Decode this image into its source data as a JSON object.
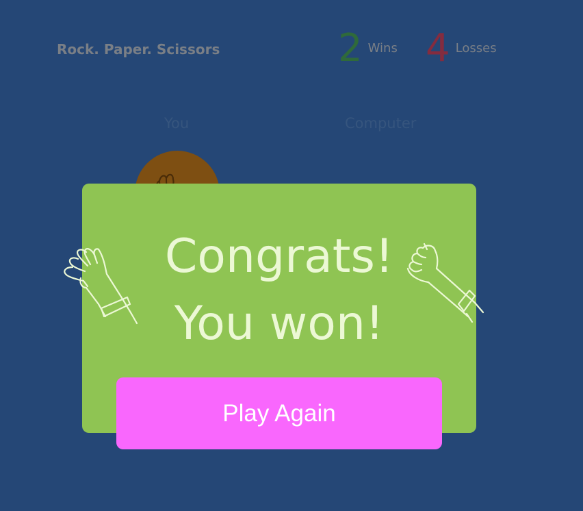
{
  "header": {
    "title": "Rock. Paper. Scissors"
  },
  "score": {
    "wins": {
      "value": "2",
      "label": "Wins",
      "color": "#2f6a3a"
    },
    "losses": {
      "value": "4",
      "label": "Losses",
      "color": "#842c3f"
    }
  },
  "players": {
    "you_label": "You",
    "computer_label": "Computer",
    "you_choice_icon": "hand-icon"
  },
  "modal": {
    "line1": "Congrats!",
    "line2": "You won!",
    "button_label": "Play Again",
    "background": "#8fc453",
    "button_color": "#f967fd",
    "decoration_left": "waving-hand-icon",
    "decoration_right": "fist-hand-icon"
  },
  "colors": {
    "background": "#254776"
  }
}
